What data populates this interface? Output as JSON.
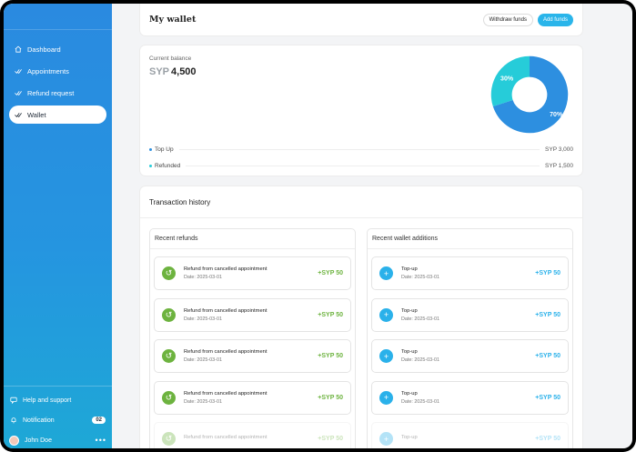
{
  "sidebar": {
    "items": [
      {
        "label": "Dashboard",
        "icon": "home-icon"
      },
      {
        "label": "Appointments",
        "icon": "checkmark-icon"
      },
      {
        "label": "Refund request",
        "icon": "checkmark-icon"
      },
      {
        "label": "Wallet",
        "icon": "checkmark-icon",
        "active": true
      }
    ],
    "help_label": "Help and support",
    "notification_label": "Notification",
    "notification_count": "02",
    "user_name": "John Doe"
  },
  "header": {
    "title": "My wallet",
    "withdraw_label": "Withdraw funds",
    "add_label": "Add funds"
  },
  "balance": {
    "label": "Current balance",
    "currency": "SYP",
    "amount": "4,500",
    "breakdown": [
      {
        "label": "Top Up",
        "value": "SYP 3,000",
        "color": "#2d8fe0",
        "percent": 70,
        "percent_label": "70%"
      },
      {
        "label": "Refunded",
        "value": "SYP 1,500",
        "color": "#26ccd9",
        "percent": 30,
        "percent_label": "30%"
      }
    ]
  },
  "transactions": {
    "title": "Transaction history",
    "refunds": {
      "title": "Recent refunds",
      "items": [
        {
          "title": "Refund from cancelled appointment",
          "date": "Date: 2025-03-01",
          "amount": "+SYP 50"
        },
        {
          "title": "Refund from cancelled appointment",
          "date": "Date: 2025-03-01",
          "amount": "+SYP 50"
        },
        {
          "title": "Refund from cancelled appointment",
          "date": "Date: 2025-03-01",
          "amount": "+SYP 50"
        },
        {
          "title": "Refund from cancelled appointment",
          "date": "Date: 2025-03-01",
          "amount": "+SYP 50"
        },
        {
          "title": "Refund from cancelled appointment",
          "date": "",
          "amount": "+SYP 50"
        }
      ]
    },
    "additions": {
      "title": "Recent wallet additions",
      "items": [
        {
          "title": "Top-up",
          "date": "Date: 2025-03-01",
          "amount": "+SYP 50"
        },
        {
          "title": "Top-up",
          "date": "Date: 2025-03-01",
          "amount": "+SYP 50"
        },
        {
          "title": "Top-up",
          "date": "Date: 2025-03-01",
          "amount": "+SYP 50"
        },
        {
          "title": "Top-up",
          "date": "Date: 2025-03-01",
          "amount": "+SYP 50"
        },
        {
          "title": "Top-up",
          "date": "",
          "amount": "+SYP 50"
        }
      ]
    }
  }
}
